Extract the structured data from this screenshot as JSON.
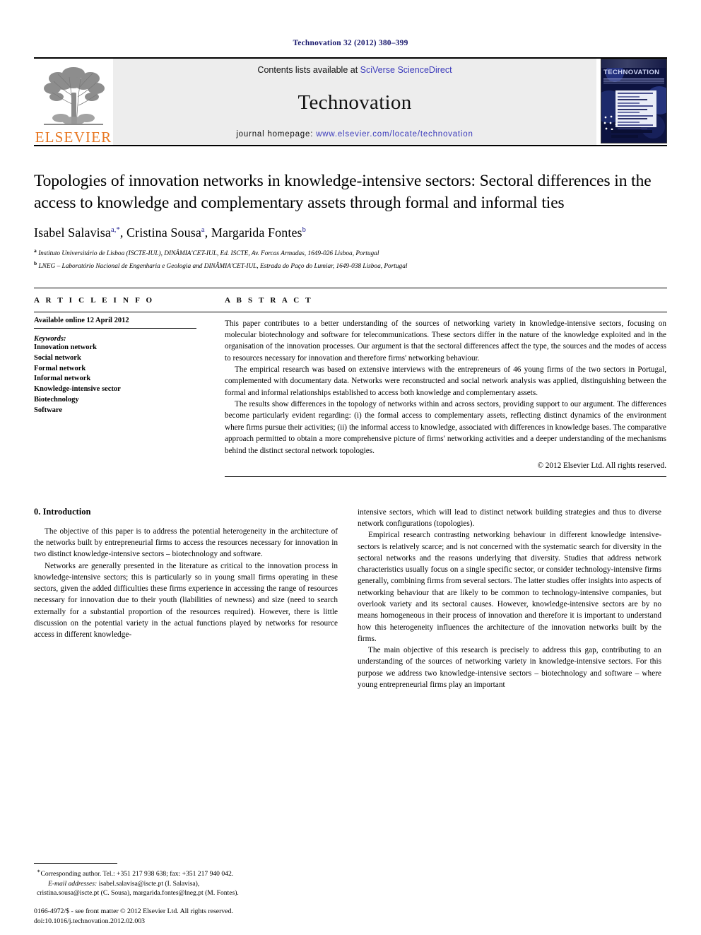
{
  "running_head": "Technovation 32 (2012) 380–399",
  "masthead": {
    "publisher_name": "ELSEVIER",
    "contents_prefix": "Contents lists available at ",
    "contents_link": "SciVerse ScienceDirect",
    "journal_title": "Technovation",
    "homepage_prefix": "journal homepage: ",
    "homepage_link": "www.elsevier.com/locate/technovation",
    "cover_title": "TECHNOVATION"
  },
  "article": {
    "title": "Topologies of innovation networks in knowledge-intensive sectors: Sectoral differences in the access to knowledge and complementary assets through formal and informal ties",
    "authors": "Isabel Salavisa",
    "author_list": [
      {
        "name": "Isabel Salavisa",
        "marks": "a,*"
      },
      {
        "name": "Cristina Sousa",
        "marks": "a"
      },
      {
        "name": "Margarida Fontes",
        "marks": "b"
      }
    ],
    "affiliations": [
      {
        "mark": "a",
        "text": "Instituto Universitário de Lisboa (ISCTE-IUL), DINÂMIA'CET-IUL, Ed. ISCTE, Av. Forcas Armadas, 1649-026 Lisboa, Portugal"
      },
      {
        "mark": "b",
        "text": "LNEG – Laboratório Nacional de Engenharia e Geologia and DINÂMIA'CET-IUL, Estrada do Paço do Lumiar, 1649-038 Lisboa, Portugal"
      }
    ]
  },
  "article_info": {
    "heading": "A R T I C L E    I N F O",
    "available_online": "Available online 12 April 2012",
    "keywords_label": "Keywords:",
    "keywords": [
      "Innovation network",
      "Social network",
      "Formal network",
      "Informal network",
      "Knowledge-intensive sector",
      "Biotechnology",
      "Software"
    ]
  },
  "abstract": {
    "heading": "A B S T R A C T",
    "paragraphs": [
      "This paper contributes to a better understanding of the sources of networking variety in knowledge-intensive sectors, focusing on molecular biotechnology and software for telecommunications. These sectors differ in the nature of the knowledge exploited and in the organisation of the innovation processes. Our argument is that the sectoral differences affect the type, the sources and the modes of access to resources necessary for innovation and therefore firms' networking behaviour.",
      "The empirical research was based on extensive interviews with the entrepreneurs of 46 young firms of the two sectors in Portugal, complemented with documentary data. Networks were reconstructed and social network analysis was applied, distinguishing between the formal and informal relationships established to access both knowledge and complementary assets.",
      "The results show differences in the topology of networks within and across sectors, providing support to our argument. The differences become particularly evident regarding: (i) the formal access to complementary assets, reflecting distinct dynamics of the environment where firms pursue their activities; (ii) the informal access to knowledge, associated with differences in knowledge bases. The comparative approach permitted to obtain a more comprehensive picture of firms' networking activities and a deeper understanding of the mechanisms behind the distinct sectoral network topologies."
    ],
    "copyright": "© 2012 Elsevier Ltd. All rights reserved."
  },
  "introduction": {
    "heading": "0.  Introduction",
    "left_paragraphs": [
      "The objective of this paper is to address the potential heterogeneity in the architecture of the networks built by entrepreneurial firms to access the resources necessary for innovation in two distinct knowledge-intensive sectors – biotechnology and software.",
      "Networks are generally presented in the literature as critical to the innovation process in knowledge-intensive sectors; this is particularly so in young small firms operating in these sectors, given the added difficulties these firms experience in accessing the range of resources necessary for innovation due to their youth (liabilities of newness) and size (need to search externally for a substantial proportion of the resources required). However, there is little discussion on the potential variety in the actual functions played by networks for resource access in different knowledge-"
    ],
    "right_paragraphs": [
      "intensive sectors, which will lead to distinct network building strategies and thus to diverse network configurations (topologies).",
      "Empirical research contrasting networking behaviour in different knowledge intensive-sectors is relatively scarce; and is not concerned with the systematic search for diversity in the sectoral networks and the reasons underlying that diversity. Studies that address network characteristics usually focus on a single specific sector, or consider technology-intensive firms generally, combining firms from several sectors. The latter studies offer insights into aspects of networking behaviour that are likely to be common to technology-intensive companies, but overlook variety and its sectoral causes. However, knowledge-intensive sectors are by no means homogeneous in their process of innovation and therefore it is important to understand how this heterogeneity influences the architecture of the innovation networks built by the firms.",
      "The main objective of this research is precisely to address this gap, contributing to an understanding of the sources of networking variety in knowledge-intensive sectors. For this purpose we address two knowledge-intensive sectors – biotechnology and software – where young entrepreneurial firms play an important"
    ]
  },
  "footnotes": {
    "corresponding": "Corresponding author. Tel.: +351 217 938 638; fax: +351 217 940 042.",
    "email_label": "E-mail addresses:",
    "emails_line1": "isabel.salavisa@iscte.pt (I. Salavisa),",
    "emails_line2": "cristina.sousa@iscte.pt (C. Sousa), margarida.fontes@lneg.pt (M. Fontes)."
  },
  "imprint": {
    "line1": "0166-4972/$ - see front matter © 2012 Elsevier Ltd. All rights reserved.",
    "line2": "doi:10.1016/j.technovation.2012.02.003"
  }
}
